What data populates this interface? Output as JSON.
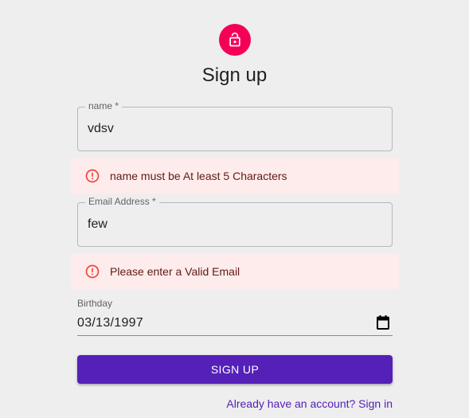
{
  "header": {
    "title": "Sign up",
    "avatar_icon": "lock-open-icon",
    "avatar_color": "#f50057"
  },
  "form": {
    "name": {
      "label": "name *",
      "value": "vdsv",
      "error": "name must be At least 5 Characters"
    },
    "email": {
      "label": "Email Address *",
      "value": "few",
      "error": "Please enter a Valid Email"
    },
    "birthday": {
      "label": "Birthday",
      "value": "03/13/1997",
      "icon": "calendar-icon"
    },
    "submit_label": "SIGN UP",
    "signin_link": "Already have an account? Sign in"
  },
  "colors": {
    "primary": "#5420b8",
    "error_bg": "#fdeceb",
    "error_icon": "#f44336",
    "error_text": "#611a15",
    "background": "#eeeeee"
  }
}
